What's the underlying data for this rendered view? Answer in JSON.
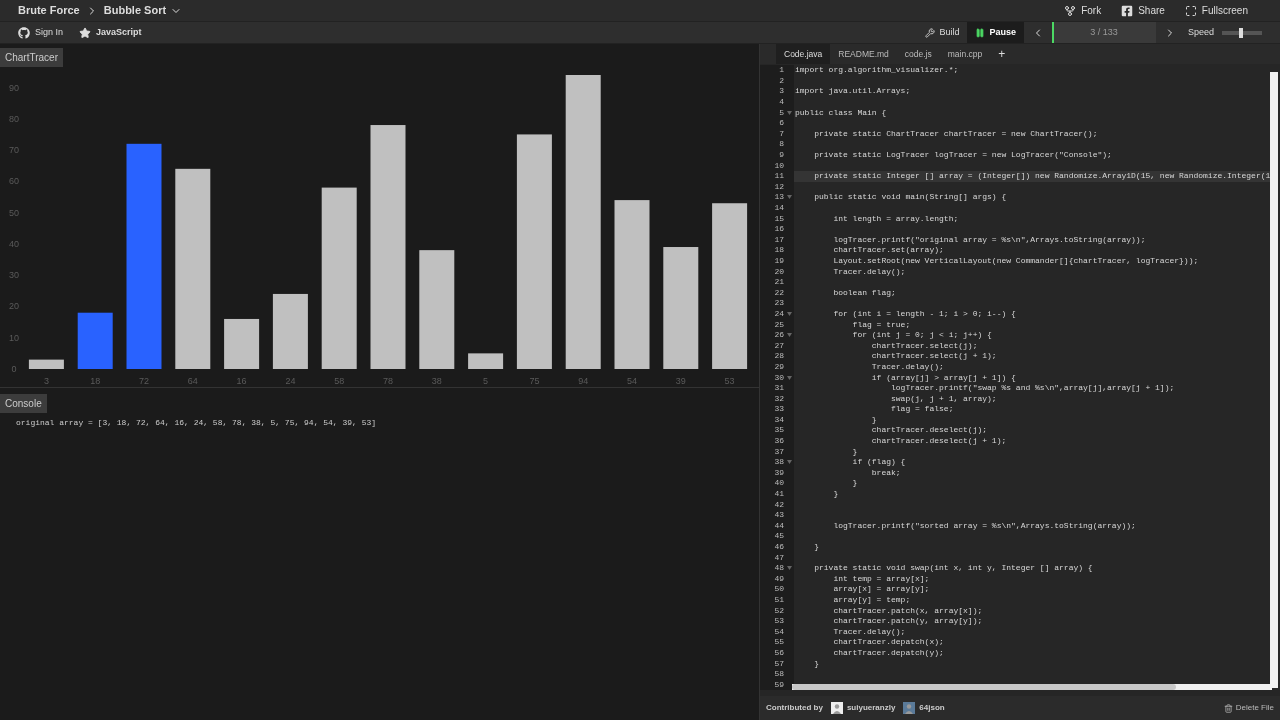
{
  "header": {
    "breadcrumb": [
      "Brute Force",
      "Bubble Sort"
    ],
    "actions": [
      {
        "kind": "fork",
        "label": "Fork"
      },
      {
        "kind": "share",
        "label": "Share"
      },
      {
        "kind": "fullscreen",
        "label": "Fullscreen"
      }
    ]
  },
  "toolbar": {
    "left": [
      {
        "kind": "github",
        "label": "Sign In"
      },
      {
        "kind": "star",
        "label": "JavaScript"
      }
    ],
    "build": "Build",
    "pause": {
      "label": "Pause",
      "selected": true
    },
    "progress": {
      "label": "3 / 133",
      "level": 0.023
    },
    "speed": {
      "label": "Speed",
      "level": 0.48
    }
  },
  "chart": {
    "title": "ChartTracer",
    "bars": [
      {
        "selected": false
      },
      {
        "selected": true
      },
      {
        "selected": true
      },
      {
        "selected": false
      },
      {
        "selected": false
      },
      {
        "selected": false
      },
      {
        "selected": false
      },
      {
        "selected": false
      },
      {
        "selected": false
      },
      {
        "selected": false
      },
      {
        "selected": false
      },
      {
        "selected": false
      },
      {
        "selected": false
      },
      {
        "selected": false
      },
      {
        "selected": false
      }
    ],
    "chart_data": {
      "type": "bar",
      "categories": [
        "3",
        "18",
        "72",
        "64",
        "16",
        "24",
        "58",
        "78",
        "38",
        "5",
        "75",
        "94",
        "54",
        "39",
        "53"
      ],
      "series": [
        {
          "values": [
            3,
            18,
            72,
            64,
            16,
            24,
            58,
            78,
            38,
            5,
            75,
            94,
            54,
            39,
            53
          ]
        }
      ],
      "ylim": [
        0,
        94
      ],
      "yticks": [
        0,
        10,
        20,
        30,
        40,
        50,
        60,
        70,
        80,
        90
      ]
    }
  },
  "console": {
    "title": "Console",
    "lines": [
      "original array = [3, 18, 72, 64, 16, 24, 58, 78, 38, 5, 75, 94, 54, 39, 53]"
    ]
  },
  "editor": {
    "tabs": [
      {
        "label": "Code.java",
        "selected": true
      },
      {
        "label": "README.md",
        "selected": false
      },
      {
        "label": "code.js",
        "selected": false
      },
      {
        "label": "main.cpp",
        "selected": false
      }
    ],
    "add_tab": "+",
    "lines": [
      {
        "n": "1",
        "text": "import org.algorithm_visualizer.*;",
        "fold": false,
        "current": false
      },
      {
        "n": "2",
        "fold": false,
        "current": false
      },
      {
        "n": "3",
        "text": "import java.util.Arrays;",
        "fold": false,
        "current": false
      },
      {
        "n": "4",
        "fold": false,
        "current": false
      },
      {
        "n": "5",
        "text": "public class Main {",
        "fold": true,
        "current": false
      },
      {
        "n": "6",
        "fold": false,
        "current": false
      },
      {
        "n": "7",
        "text": "    private static ChartTracer chartTracer = new ChartTracer();",
        "fold": false,
        "current": false
      },
      {
        "n": "8",
        "fold": false,
        "current": false
      },
      {
        "n": "9",
        "text": "    private static LogTracer logTracer = new LogTracer(\"Console\");",
        "fold": false,
        "current": false
      },
      {
        "n": "10",
        "fold": false,
        "current": false
      },
      {
        "n": "11",
        "text": "    private static Integer [] array = (Integer[]) new Randomize.Array1D(15, new Randomize.Integer(1",
        "fold": false,
        "current": true
      },
      {
        "n": "12",
        "fold": false,
        "current": false
      },
      {
        "n": "13",
        "text": "    public static void main(String[] args) {",
        "fold": true,
        "current": false
      },
      {
        "n": "14",
        "fold": false,
        "current": false
      },
      {
        "n": "15",
        "text": "        int length = array.length;",
        "fold": false,
        "current": false
      },
      {
        "n": "16",
        "fold": false,
        "current": false
      },
      {
        "n": "17",
        "text": "        logTracer.printf(\"original array = %s\\n\",Arrays.toString(array));",
        "fold": false,
        "current": false
      },
      {
        "n": "18",
        "text": "        chartTracer.set(array);",
        "fold": false,
        "current": false
      },
      {
        "n": "19",
        "text": "        Layout.setRoot(new VerticalLayout(new Commander[]{chartTracer, logTracer}));",
        "fold": false,
        "current": false
      },
      {
        "n": "20",
        "text": "        Tracer.delay();",
        "fold": false,
        "current": false
      },
      {
        "n": "21",
        "fold": false,
        "current": false
      },
      {
        "n": "22",
        "text": "        boolean flag;",
        "fold": false,
        "current": false
      },
      {
        "n": "23",
        "fold": false,
        "current": false
      },
      {
        "n": "24",
        "text": "        for (int i = length - 1; i > 0; i--) {",
        "fold": true,
        "current": false
      },
      {
        "n": "25",
        "text": "            flag = true;",
        "fold": false,
        "current": false
      },
      {
        "n": "26",
        "text": "            for (int j = 0; j < i; j++) {",
        "fold": true,
        "current": false
      },
      {
        "n": "27",
        "text": "                chartTracer.select(j);",
        "fold": false,
        "current": false
      },
      {
        "n": "28",
        "text": "                chartTracer.select(j + 1);",
        "fold": false,
        "current": false
      },
      {
        "n": "29",
        "text": "                Tracer.delay();",
        "fold": false,
        "current": false
      },
      {
        "n": "30",
        "text": "                if (array[j] > array[j + 1]) {",
        "fold": true,
        "current": false
      },
      {
        "n": "31",
        "text": "                    logTracer.printf(\"swap %s and %s\\n\",array[j],array[j + 1]);",
        "fold": false,
        "current": false
      },
      {
        "n": "32",
        "text": "                    swap(j, j + 1, array);",
        "fold": false,
        "current": false
      },
      {
        "n": "33",
        "text": "                    flag = false;",
        "fold": false,
        "current": false
      },
      {
        "n": "34",
        "text": "                }",
        "fold": false,
        "current": false
      },
      {
        "n": "35",
        "text": "                chartTracer.deselect(j);",
        "fold": false,
        "current": false
      },
      {
        "n": "36",
        "text": "                chartTracer.deselect(j + 1);",
        "fold": false,
        "current": false
      },
      {
        "n": "37",
        "text": "            }",
        "fold": false,
        "current": false
      },
      {
        "n": "38",
        "text": "            if (flag) {",
        "fold": true,
        "current": false
      },
      {
        "n": "39",
        "text": "                break;",
        "fold": false,
        "current": false
      },
      {
        "n": "40",
        "text": "            }",
        "fold": false,
        "current": false
      },
      {
        "n": "41",
        "text": "        }",
        "fold": false,
        "current": false
      },
      {
        "n": "42",
        "fold": false,
        "current": false
      },
      {
        "n": "43",
        "fold": false,
        "current": false
      },
      {
        "n": "44",
        "text": "        logTracer.printf(\"sorted array = %s\\n\",Arrays.toString(array));",
        "fold": false,
        "current": false
      },
      {
        "n": "45",
        "fold": false,
        "current": false
      },
      {
        "n": "46",
        "text": "    }",
        "fold": false,
        "current": false
      },
      {
        "n": "47",
        "fold": false,
        "current": false
      },
      {
        "n": "48",
        "text": "    private static void swap(int x, int y, Integer [] array) {",
        "fold": true,
        "current": false
      },
      {
        "n": "49",
        "text": "        int temp = array[x];",
        "fold": false,
        "current": false
      },
      {
        "n": "50",
        "text": "        array[x] = array[y];",
        "fold": false,
        "current": false
      },
      {
        "n": "51",
        "text": "        array[y] = temp;",
        "fold": false,
        "current": false
      },
      {
        "n": "52",
        "text": "        chartTracer.patch(x, array[x]);",
        "fold": false,
        "current": false
      },
      {
        "n": "53",
        "text": "        chartTracer.patch(y, array[y]);",
        "fold": false,
        "current": false
      },
      {
        "n": "54",
        "text": "        Tracer.delay();",
        "fold": false,
        "current": false
      },
      {
        "n": "55",
        "text": "        chartTracer.depatch(x);",
        "fold": false,
        "current": false
      },
      {
        "n": "56",
        "text": "        chartTracer.depatch(y);",
        "fold": false,
        "current": false
      },
      {
        "n": "57",
        "text": "    }",
        "fold": false,
        "current": false
      },
      {
        "n": "58",
        "fold": false,
        "current": false
      },
      {
        "n": "59",
        "fold": false,
        "current": false
      }
    ]
  },
  "footer": {
    "label": "Contributed by",
    "contributors": [
      "suiyueranzly",
      "64json"
    ],
    "delete": "Delete File"
  }
}
